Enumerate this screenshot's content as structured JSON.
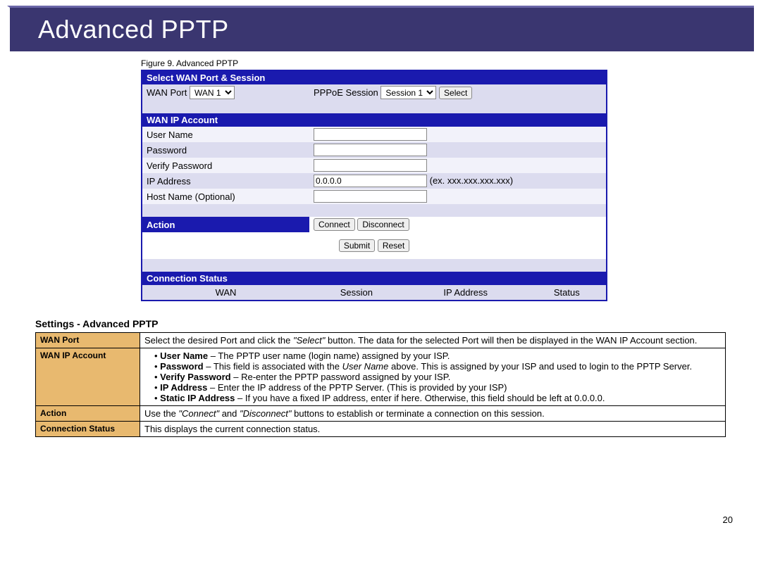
{
  "header": {
    "title": "Advanced PPTP"
  },
  "figure_caption": "Figure 9.  Advanced PPTP",
  "form": {
    "select_section": "Select WAN Port & Session",
    "wan_port_label": "WAN Port",
    "wan_port_value": "WAN 1",
    "pppoe_label": "PPPoE Session",
    "pppoe_value": "Session 1",
    "select_btn": "Select",
    "wan_ip_section": "WAN IP Account",
    "user_name_label": "User Name",
    "password_label": "Password",
    "verify_password_label": "Verify Password",
    "ip_address_label": "IP Address",
    "ip_address_value": "0.0.0.0",
    "ip_address_hint": "(ex. xxx.xxx.xxx.xxx)",
    "host_name_label": "Host Name (Optional)",
    "action_section": "Action",
    "connect_btn": "Connect",
    "disconnect_btn": "Disconnect",
    "submit_btn": "Submit",
    "reset_btn": "Reset",
    "conn_status_section": "Connection Status",
    "status_cols": {
      "wan": "WAN",
      "session": "Session",
      "ip": "IP Address",
      "status": "Status"
    }
  },
  "settings_title": "Settings - Advanced PPTP",
  "desc": {
    "wan_port": {
      "key": "WAN Port",
      "text_a": "Select the desired Port and click the ",
      "text_it1": "\"Select\"",
      "text_b": " button. The data for the selected Port will then be displayed in the WAN IP Account section."
    },
    "wan_ip": {
      "key": "WAN IP Account",
      "b1a": "User Name",
      "b1b": " – The PPTP user name (login name) assigned by your ISP.",
      "b2a": "Password",
      "b2b": " – This field is associated with the ",
      "b2it": "User Name",
      "b2c": " above. This is assigned by your ISP and used to login to the PPTP Server.",
      "b3a": "Verify Password",
      "b3b": " – Re-enter the PPTP password assigned by your ISP.",
      "b4a": "IP Address",
      "b4b": " – Enter the IP address of the PPTP Server. (This is provided by your ISP)",
      "b5a": "Static IP Address",
      "b5b": " – If you have a fixed IP address, enter if here. Otherwise, this field should be left at 0.0.0.0."
    },
    "action": {
      "key": "Action",
      "a": "Use the ",
      "it1": "\"Connect\"",
      "b": " and ",
      "it2": "\"Disconnect\"",
      "c": " buttons to establish or terminate a connection on this session."
    },
    "conn": {
      "key": "Connection Status",
      "text": "This displays the current connection status."
    }
  },
  "page_number": "20"
}
